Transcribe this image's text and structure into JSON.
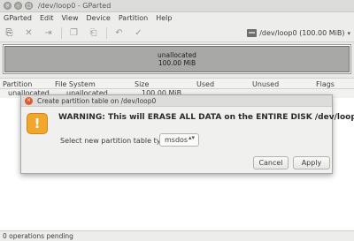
{
  "window": {
    "title": "/dev/loop0 - GParted",
    "controls": [
      "×",
      "–",
      "□"
    ]
  },
  "menubar": {
    "items": [
      "GParted",
      "Edit",
      "View",
      "Device",
      "Partition",
      "Help"
    ]
  },
  "toolbar": {
    "icons": {
      "new": "⎘",
      "delete": "✕",
      "resize": "⇥",
      "copy": "❐",
      "paste": "⎗",
      "undo": "↶",
      "apply": "✓"
    },
    "device": {
      "label": "/dev/loop0   (100.00 MiB)",
      "arrow": "▾"
    }
  },
  "graph": {
    "label": "unallocated",
    "size": "100.00 MiB"
  },
  "table": {
    "columns": [
      "Partition",
      "File System",
      "Size",
      "Used",
      "Unused",
      "Flags"
    ],
    "row": {
      "partition": "unallocated",
      "filesystem": "unallocated",
      "size": "100.00 MiB"
    }
  },
  "status": {
    "text": "0 operations pending"
  },
  "dialog": {
    "title": "Create partition table on /dev/loop0",
    "close_glyph": "×",
    "icon_glyph": "!",
    "warning": "WARNING:  This will ERASE ALL DATA on the ENTIRE DISK /dev/loop0",
    "select_label": "Select new partition table type:",
    "select_value": "msdos",
    "select_arrows": "▴▾",
    "cancel_label": "Cancel",
    "apply_label": "Apply"
  }
}
